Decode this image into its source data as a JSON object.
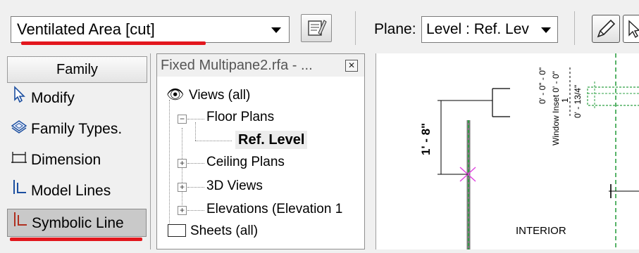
{
  "toolbar": {
    "type_selector_value": "Ventilated Area [cut]",
    "plane_label": "Plane:",
    "plane_value": "Level : Ref. Lev"
  },
  "design_bar": {
    "tab": "Family",
    "tools": [
      {
        "label": "Modify",
        "icon": "cursor-arrow-icon"
      },
      {
        "label": "Family Types.",
        "icon": "family-types-icon"
      },
      {
        "label": "Dimension",
        "icon": "dimension-icon"
      },
      {
        "label": "Model Lines",
        "icon": "model-lines-icon"
      },
      {
        "label": "Symbolic Line",
        "icon": "symbolic-lines-icon"
      }
    ]
  },
  "project_browser": {
    "title": "Fixed Multipane2.rfa - ...",
    "tree": {
      "views": "Views (all)",
      "floor_plans": "Floor Plans",
      "ref_level": "Ref. Level",
      "ceiling_plans": "Ceiling Plans",
      "views_3d": "3D Views",
      "elevations": "Elevations (Elevation 1",
      "sheets": "Sheets (all)"
    }
  },
  "canvas": {
    "dim_vertical": "1' - 8\"",
    "dim_zero": "0' - 0\" - 0\"",
    "dim_window": "Window Inset 0' - 0\"",
    "dim_small": "0' - 13/4\"",
    "dim_one": "1",
    "label_interior": "INTERIOR"
  },
  "colors": {
    "highlight_red": "#e2171d",
    "green_line": "#2ea043",
    "magenta_marker": "#e040e0"
  }
}
